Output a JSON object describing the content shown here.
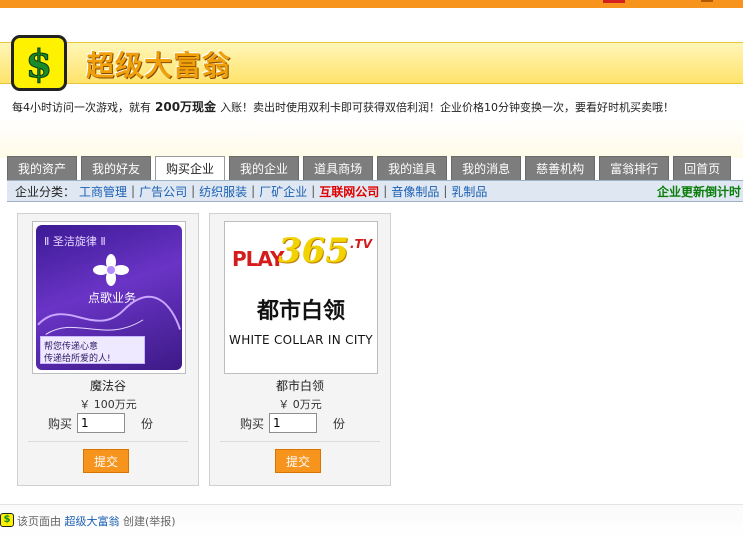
{
  "header": {
    "title": "超级大富翁",
    "logo_icon": "dollar-sign-icon"
  },
  "intro": {
    "part1": "每4小时访问一次游戏，就有",
    "highlight": "200万现金",
    "part2": "入账！卖出时使用双利卡即可获得双倍利润！企业价格10分钟变换一次，要看好时机买卖哦！"
  },
  "tabs": [
    {
      "label": "我的资产",
      "active": false
    },
    {
      "label": "我的好友",
      "active": false
    },
    {
      "label": "购买企业",
      "active": true
    },
    {
      "label": "我的企业",
      "active": false
    },
    {
      "label": "道具商场",
      "active": false
    },
    {
      "label": "我的道具",
      "active": false
    },
    {
      "label": "我的消息",
      "active": false
    },
    {
      "label": "慈善机构",
      "active": false
    },
    {
      "label": "富翁排行",
      "active": false
    },
    {
      "label": "回首页",
      "active": false
    }
  ],
  "categories": {
    "label": "企业分类：",
    "items": [
      {
        "label": "工商管理",
        "active": false
      },
      {
        "label": "广告公司",
        "active": false
      },
      {
        "label": "纺织服装",
        "active": false
      },
      {
        "label": "厂矿企业",
        "active": false
      },
      {
        "label": "互联网公司",
        "active": true
      },
      {
        "label": "音像制品",
        "active": false
      },
      {
        "label": "乳制品",
        "active": false
      }
    ],
    "countdown": "企业更新倒计时"
  },
  "products": [
    {
      "name": "魔法谷",
      "price": "￥ 100万元",
      "buy_label": "购买",
      "quantity": "1",
      "unit": "份",
      "submit_label": "提交",
      "image": {
        "line1": "Ⅱ 圣洁旋律 Ⅱ",
        "line2": "点歌业务",
        "line3": "帮您传递心意",
        "line4": "传递给所爱的人!"
      }
    },
    {
      "name": "都市白领",
      "price": "￥ 0万元",
      "buy_label": "购买",
      "quantity": "1",
      "unit": "份",
      "submit_label": "提交",
      "image": {
        "play": "PLAY",
        "num": "365",
        "tv": ".TV",
        "cn": "都市白领",
        "en": "WHITE COLLAR IN CITY"
      }
    }
  ],
  "footer": {
    "text_before": "该页面由",
    "link": "超级大富翁",
    "text_after": "创建(举报)"
  },
  "colors": {
    "accent": "#f7941d",
    "tab_gray": "#7d7d7d",
    "link_blue": "#1b5fb3",
    "active_red": "#e00000",
    "countdown_green": "#0a7d0a"
  }
}
